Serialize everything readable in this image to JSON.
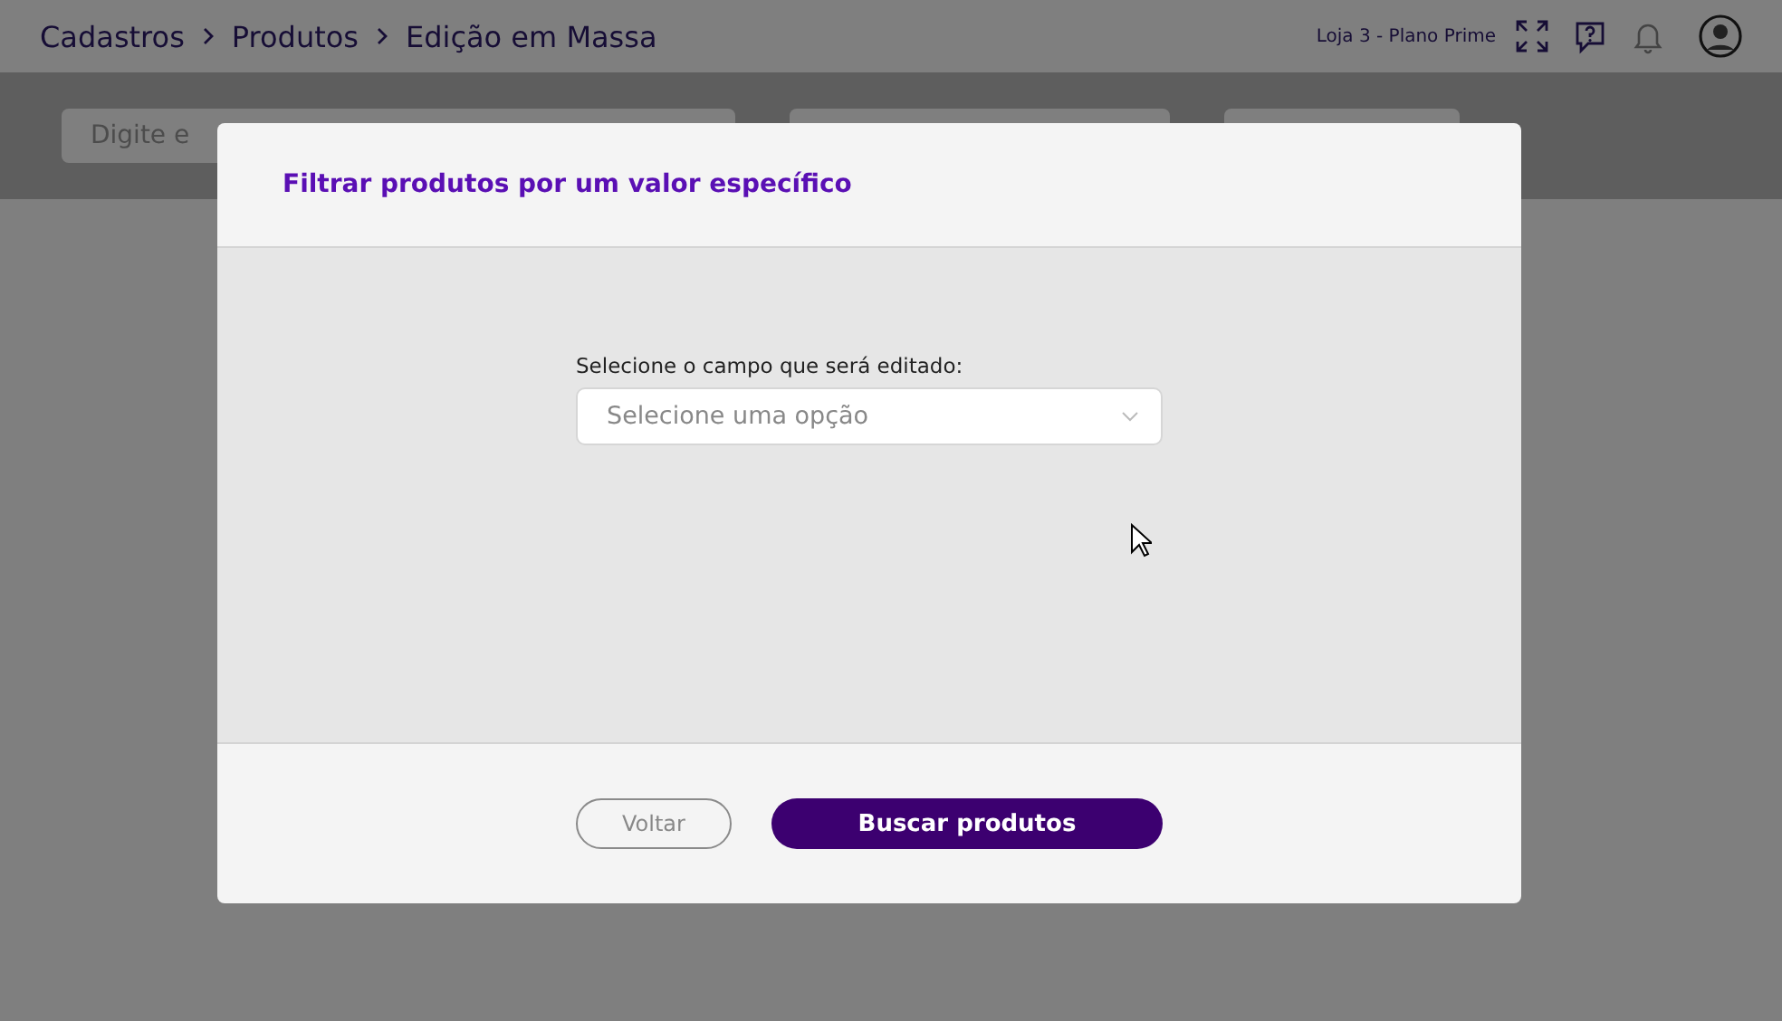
{
  "breadcrumbs": [
    "Cadastros",
    "Produtos",
    "Edição em Massa"
  ],
  "header": {
    "store": "Loja 3 - Plano Prime"
  },
  "toolbar": {
    "search": {
      "placeholder": "Digite e"
    }
  },
  "modal": {
    "title": "Filtrar produtos por um valor específico",
    "field": {
      "label": "Selecione o campo que será editado:",
      "placeholder": "Selecione uma opção"
    },
    "buttons": [
      {
        "label": "Voltar",
        "kind": "secondary"
      },
      {
        "label": "Buscar produtos",
        "kind": "primary"
      }
    ]
  }
}
